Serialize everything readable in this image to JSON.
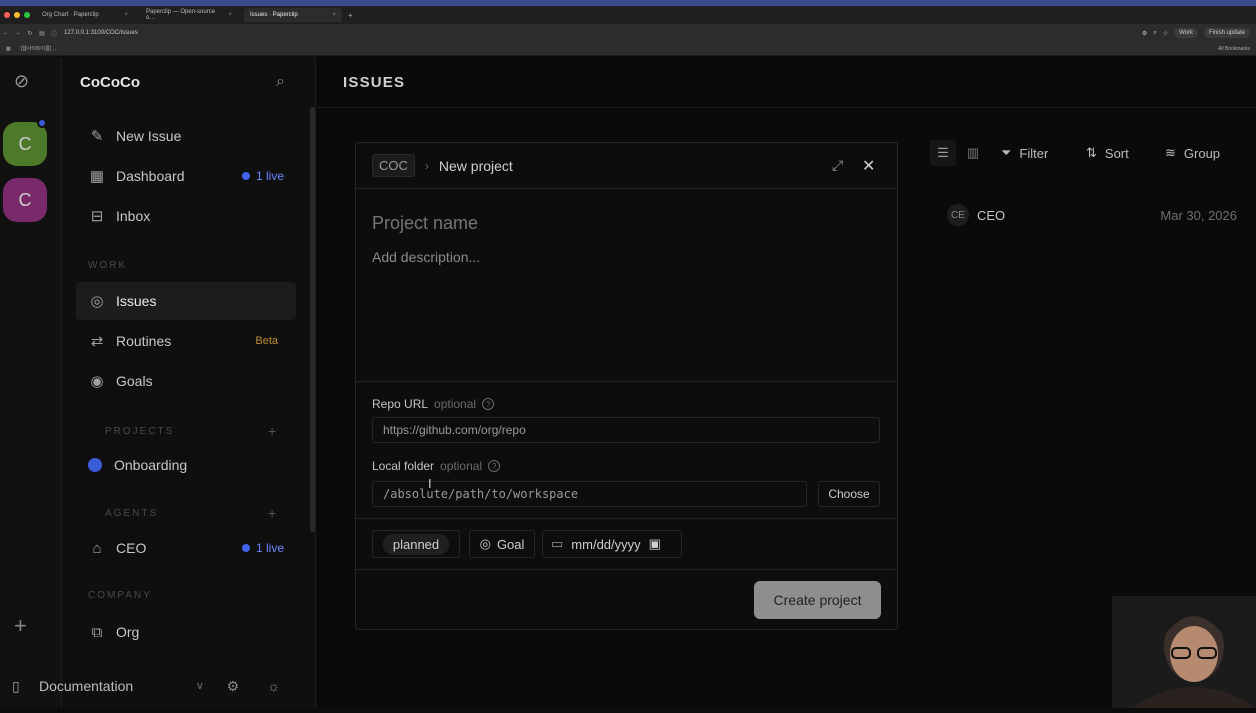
{
  "browser": {
    "tabs": [
      {
        "label": "Org Chart · Paperclip",
        "active": false
      },
      {
        "label": "Paperclip — Open-source o…",
        "active": false
      },
      {
        "label": "Issues · Paperclip",
        "active": true
      }
    ],
    "url": "127.0.0.1:3100/COC/issues",
    "bookmark_item": "[웹사이트이름] ...",
    "profile_label": "Work",
    "update_label": "Finish update",
    "all_bookmarks": "All Bookmarks"
  },
  "rail": {
    "companies": [
      {
        "letter": "C",
        "color": "#4d7a2a"
      },
      {
        "letter": "C",
        "color": "#7a2a6a"
      }
    ],
    "add_label": "+"
  },
  "sidebar": {
    "title": "CoCoCo",
    "new_issue": "New Issue",
    "dashboard": "Dashboard",
    "dashboard_badge": "1 live",
    "inbox": "Inbox",
    "section_work": "WORK",
    "issues": "Issues",
    "routines": "Routines",
    "routines_badge": "Beta",
    "goals": "Goals",
    "section_projects": "PROJECTS",
    "project_onboarding": "Onboarding",
    "section_agents": "AGENTS",
    "agent_ceo": "CEO",
    "agent_badge": "1 live",
    "section_company": "COMPANY",
    "org": "Org",
    "documentation": "Documentation",
    "version": "v"
  },
  "main": {
    "title": "ISSUES",
    "filter_label": "Filter",
    "sort_label": "Sort",
    "group_label": "Group",
    "issue_row": {
      "avatar": "CE",
      "assignee": "CEO",
      "date": "Mar 30, 2026"
    }
  },
  "modal": {
    "crumb_company": "COC",
    "crumb_title": "New project",
    "name_placeholder": "Project name",
    "description_placeholder": "Add description...",
    "repo_label": "Repo URL",
    "repo_optional": "optional",
    "repo_placeholder": "https://github.com/org/repo",
    "folder_label": "Local folder",
    "folder_optional": "optional",
    "folder_placeholder": "/absolute/path/to/workspace",
    "choose_label": "Choose",
    "status_chip": "planned",
    "goal_chip": "Goal",
    "date_chip": "mm/dd/yyyy",
    "create_label": "Create project"
  }
}
